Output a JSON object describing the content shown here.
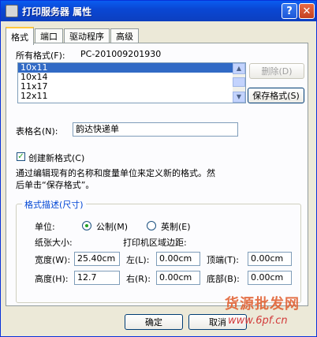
{
  "window": {
    "title": "打印服务器 属性"
  },
  "tabs": [
    "格式",
    "端口",
    "驱动程序",
    "高级"
  ],
  "forms": {
    "all_formats_label": "所有格式(F):",
    "server_name": "PC-201009201930",
    "list_items": [
      "10x11",
      "10x14",
      "11x17",
      "12x11"
    ],
    "delete_button": "删除(D)",
    "save_button": "保存格式(S)",
    "form_name_label": "表格名(N):",
    "form_name_value": "韵达快递单",
    "create_new_label": "创建新格式(C)",
    "create_new_checked": true,
    "instructions_line1": "通过编辑现有的名称和度量单位来定义新的格式。然",
    "instructions_line2": "后单击“保存格式”。"
  },
  "description": {
    "group_title": "格式描述(尺寸)",
    "units_label": "单位:",
    "metric_label": "公制(M)",
    "english_label": "英制(E)",
    "metric_selected": true,
    "paper_size_label": "纸张大小:",
    "margins_label": "打印机区域边距:",
    "width_label": "宽度(W):",
    "width_value": "25.40cm",
    "height_label": "高度(H):",
    "height_value": "12.7",
    "left_label": "左(L):",
    "left_value": "0.00cm",
    "right_label": "右(R):",
    "right_value": "0.00cm",
    "top_label": "顶端(T):",
    "top_value": "0.00cm",
    "bottom_label": "底部(B):",
    "bottom_value": "0.00cm"
  },
  "buttons": {
    "ok": "确定",
    "cancel": "取消"
  },
  "watermark": {
    "line1": "货源批发网",
    "line2": "www.6pf.cn"
  },
  "icons": {
    "app": "printer-icon",
    "help": "help-icon",
    "close": "close-icon"
  }
}
